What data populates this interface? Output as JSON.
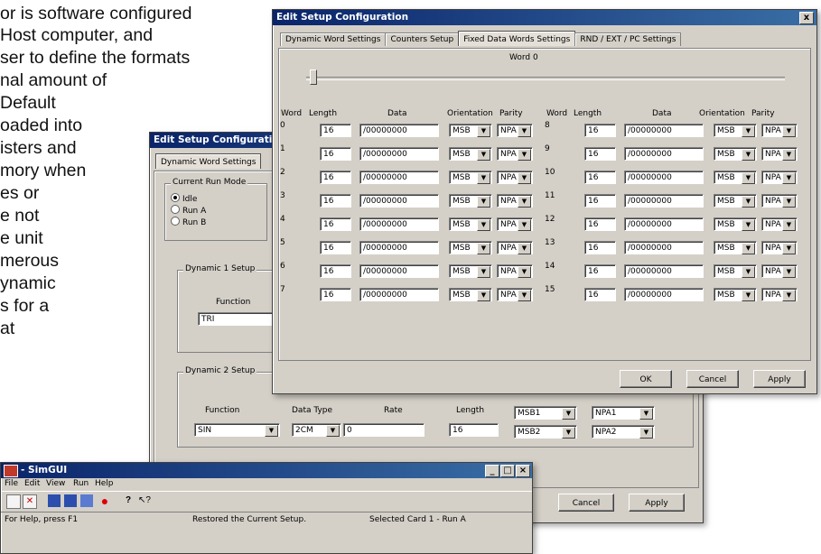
{
  "slide_text": [
    "or is software configured",
    " Host computer, and",
    "ser to define the formats",
    "nal amount of",
    "Default",
    "oaded into",
    "isters and",
    "mory when",
    "es or",
    "e not",
    "e unit",
    "merous",
    "ynamic",
    "s for a",
    "at"
  ],
  "front_dialog": {
    "title": "Edit Setup Configuration",
    "close_label": "x",
    "tabs": [
      "Dynamic Word Settings",
      "Counters Setup",
      "Fixed Data Words Settings",
      "RND / EXT / PC Settings"
    ],
    "active_tab": 2,
    "word_selector_label": "Word 0",
    "headers": [
      "Word",
      "Length",
      "Data",
      "Orientation",
      "Parity"
    ],
    "left_rows": [
      {
        "word": "0",
        "length": "16",
        "data": "/00000000",
        "orientation": "MSB",
        "parity": "NPA"
      },
      {
        "word": "1",
        "length": "16",
        "data": "/00000000",
        "orientation": "MSB",
        "parity": "NPA"
      },
      {
        "word": "2",
        "length": "16",
        "data": "/00000000",
        "orientation": "MSB",
        "parity": "NPA"
      },
      {
        "word": "3",
        "length": "16",
        "data": "/00000000",
        "orientation": "MSB",
        "parity": "NPA"
      },
      {
        "word": "4",
        "length": "16",
        "data": "/00000000",
        "orientation": "MSB",
        "parity": "NPA"
      },
      {
        "word": "5",
        "length": "16",
        "data": "/00000000",
        "orientation": "MSB",
        "parity": "NPA"
      },
      {
        "word": "6",
        "length": "16",
        "data": "/00000000",
        "orientation": "MSB",
        "parity": "NPA"
      },
      {
        "word": "7",
        "length": "16",
        "data": "/00000000",
        "orientation": "MSB",
        "parity": "NPA"
      }
    ],
    "right_rows": [
      {
        "word": "8",
        "length": "16",
        "data": "/00000000",
        "orientation": "MSB",
        "parity": "NPA"
      },
      {
        "word": "9",
        "length": "16",
        "data": "/00000000",
        "orientation": "MSB",
        "parity": "NPA"
      },
      {
        "word": "10",
        "length": "16",
        "data": "/00000000",
        "orientation": "MSB",
        "parity": "NPA"
      },
      {
        "word": "11",
        "length": "16",
        "data": "/00000000",
        "orientation": "MSB",
        "parity": "NPA"
      },
      {
        "word": "12",
        "length": "16",
        "data": "/00000000",
        "orientation": "MSB",
        "parity": "NPA"
      },
      {
        "word": "13",
        "length": "16",
        "data": "/00000000",
        "orientation": "MSB",
        "parity": "NPA"
      },
      {
        "word": "14",
        "length": "16",
        "data": "/00000000",
        "orientation": "MSB",
        "parity": "NPA"
      },
      {
        "word": "15",
        "length": "16",
        "data": "/00000000",
        "orientation": "MSB",
        "parity": "NPA"
      }
    ],
    "buttons": {
      "ok": "OK",
      "cancel": "Cancel",
      "apply": "Apply"
    }
  },
  "back_dialog": {
    "title": "Edit Setup Configuration",
    "tab": "Dynamic Word Settings",
    "run_mode": {
      "label": "Current Run Mode",
      "options": [
        "Idle",
        "Run A",
        "Run B"
      ],
      "selected": 0
    },
    "dynamic1": {
      "label": "Dynamic 1 Setup",
      "function_label": "Function",
      "function_value": "TRI"
    },
    "dynamic2": {
      "label": "Dynamic 2 Setup",
      "function_label": "Function",
      "function_value": "SIN",
      "datatype_label": "Data Type",
      "datatype_value": "2CM",
      "rate_label": "Rate",
      "rate_value": "0",
      "length_label": "Length",
      "length_value": "16",
      "msb1": "MSB1",
      "npa1": "NPA1",
      "msb2": "MSB2",
      "npa2": "NPA2"
    },
    "buttons": {
      "cancel": "Cancel",
      "apply": "Apply"
    }
  },
  "simgui": {
    "title": "- SimGUI",
    "menu": [
      "File",
      "Edit",
      "View",
      "Run",
      "Help"
    ],
    "status": [
      "For Help, press F1",
      "Restored the Current Setup.",
      "Selected Card 1 - Run A"
    ]
  }
}
